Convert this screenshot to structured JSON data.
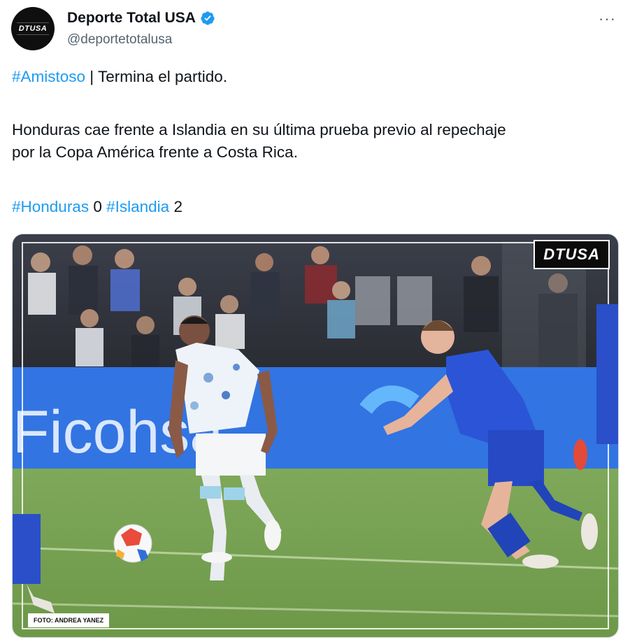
{
  "author": {
    "display_name": "Deporte Total USA",
    "handle": "@deportetotalusa",
    "avatar_text": "DTUSA",
    "verified_icon": "verified-badge-icon"
  },
  "menu": {
    "more_label": "···"
  },
  "tweet": {
    "tag_amistoso": "#Amistoso",
    "line1_rest": " | Termina el partido.",
    "line2a": "Honduras cae frente a Islandia en su última prueba previo al repechaje",
    "line2b": "por la Copa América frente a Costa Rica.",
    "tag_honduras": "#Honduras",
    "score_honduras": " 0 ",
    "tag_islandia": "#Islandia",
    "score_islandia": " 2"
  },
  "media": {
    "watermark": "DTUSA",
    "banner_text": "Ficohsa",
    "credit": "FOTO: ANDREA YANEZ"
  },
  "colors": {
    "link": "#1d9bf0",
    "verified": "#1d9bf0",
    "text": "#0f1419",
    "muted": "#536471"
  }
}
